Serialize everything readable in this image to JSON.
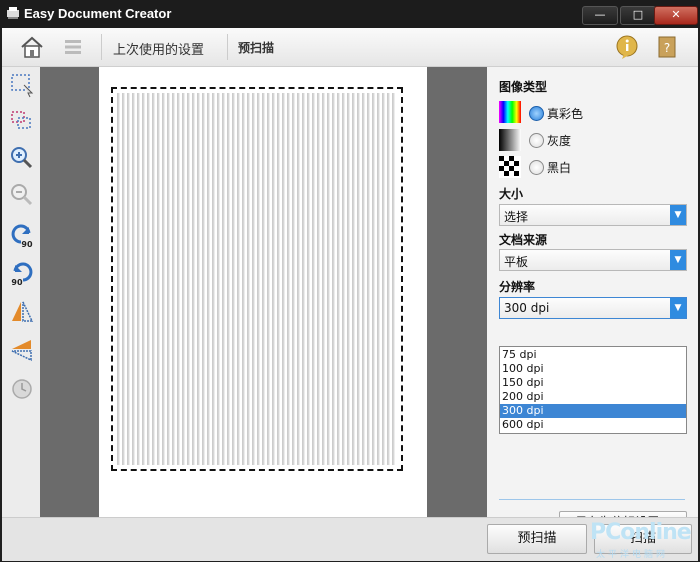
{
  "window": {
    "title": "Easy Document Creator",
    "minimize_label": "—",
    "maximize_label": "□",
    "close_label": "✕"
  },
  "toolbar": {
    "last_settings_label": "上次使用的设置",
    "prescan_label": "预扫描"
  },
  "left_tools": [
    "select-area-icon",
    "multi-select-icon",
    "zoom-in-icon",
    "zoom-out-icon",
    "rotate-left-90-icon",
    "rotate-right-90-icon",
    "flip-horizontal-icon",
    "flip-vertical-icon",
    "reset-icon"
  ],
  "settings": {
    "image_type_label": "图像类型",
    "image_types": [
      {
        "label": "真彩色",
        "selected": true
      },
      {
        "label": "灰度",
        "selected": false
      },
      {
        "label": "黑白",
        "selected": false
      }
    ],
    "size_label": "大小",
    "size_value": "选择",
    "source_label": "文档来源",
    "source_value": "平板",
    "resolution_label": "分辨率",
    "resolution_value": "300 dpi",
    "resolution_options": [
      "75 dpi",
      "100 dpi",
      "150 dpi",
      "200 dpi",
      "300 dpi",
      "600 dpi"
    ],
    "resolution_selected_index": 4,
    "save_preference_label": "另存为偏好设置..."
  },
  "bottom": {
    "prescan_button_label": "预扫描",
    "scan_button_label": "扫描"
  },
  "watermark": {
    "brand": "PConline",
    "sub": "太平洋电脑网"
  },
  "colors": {
    "accent": "#2f8be0",
    "selected_option": "#3d86d4",
    "titlebar": "#1c1c1c"
  }
}
